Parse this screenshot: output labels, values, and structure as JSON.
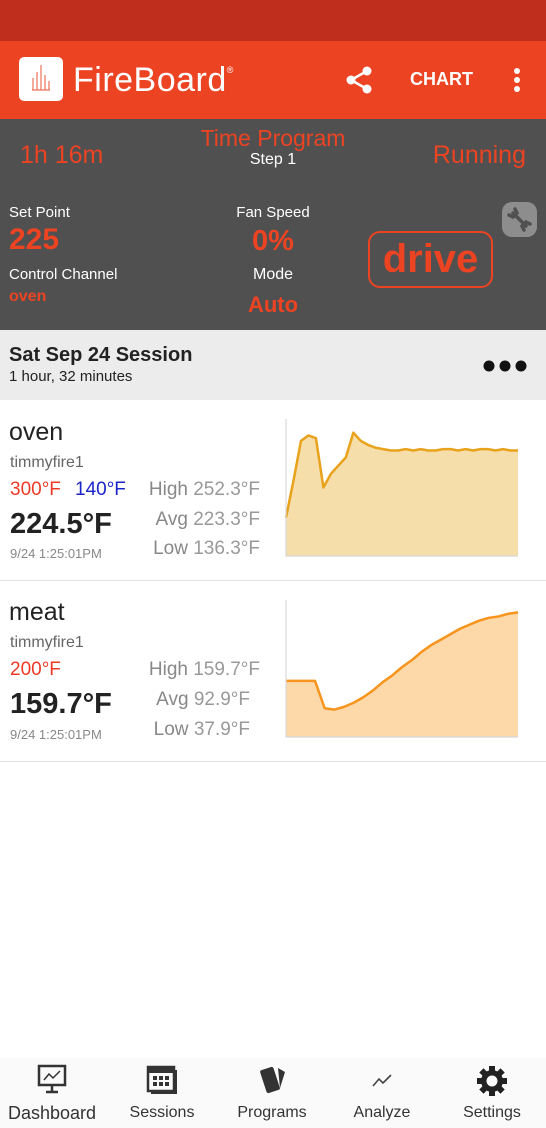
{
  "app": {
    "name": "FireBoard",
    "trademark": "®",
    "chart_label": "CHART"
  },
  "icons": {
    "logo": "fireboard-logo-icon",
    "share": "share-icon",
    "more": "more-vert-icon",
    "wrench": "wrench-icon",
    "session_more": "more-horiz-icon"
  },
  "control": {
    "elapsed": "1h 16m",
    "program_title": "Time Program",
    "program_step": "Step 1",
    "status": "Running",
    "setpoint_label": "Set Point",
    "setpoint_value": "225",
    "channel_label": "Control Channel",
    "channel_value": "oven",
    "fan_label": "Fan Speed",
    "fan_value": "0%",
    "mode_label": "Mode",
    "mode_value": "Auto",
    "drive_label": "drive"
  },
  "session": {
    "title": "Sat Sep 24 Session",
    "duration": "1 hour, 32 minutes"
  },
  "probes": [
    {
      "name": "oven",
      "device": "timmyfire1",
      "alarm_high": "300°F",
      "alarm_low": "140°F",
      "current": "224.5°F",
      "timestamp": "9/24 1:25:01PM",
      "high_label": "High",
      "high": "252.3°F",
      "avg_label": "Avg",
      "avg": "223.3°F",
      "low_label": "Low",
      "low": "136.3°F",
      "line_color": "#e8a21b",
      "fill_color": "#f6deaa",
      "trend": [
        0.28,
        0.55,
        0.84,
        0.88,
        0.86,
        0.5,
        0.6,
        0.66,
        0.72,
        0.9,
        0.84,
        0.81,
        0.79,
        0.78,
        0.77,
        0.77,
        0.78,
        0.77,
        0.78,
        0.77,
        0.77,
        0.78,
        0.78,
        0.77,
        0.78,
        0.77,
        0.78,
        0.78,
        0.77,
        0.78,
        0.77,
        0.77
      ]
    },
    {
      "name": "meat",
      "device": "timmyfire1",
      "alarm_high": "200°F",
      "alarm_low": "",
      "current": "159.7°F",
      "timestamp": "9/24 1:25:01PM",
      "high_label": "High",
      "high": "159.7°F",
      "avg_label": "Avg",
      "avg": "92.9°F",
      "low_label": "Low",
      "low": "37.9°F",
      "line_color": "#f7941d",
      "fill_color": "#fdd8a8",
      "trend": [
        0.41,
        0.41,
        0.41,
        0.41,
        0.21,
        0.2,
        0.22,
        0.25,
        0.29,
        0.34,
        0.4,
        0.45,
        0.51,
        0.56,
        0.62,
        0.67,
        0.71,
        0.75,
        0.79,
        0.82,
        0.85,
        0.87,
        0.88,
        0.9,
        0.91
      ]
    }
  ],
  "nav": [
    {
      "label": "Dashboard",
      "icon": "dashboard-icon"
    },
    {
      "label": "Sessions",
      "icon": "calendar-icon"
    },
    {
      "label": "Programs",
      "icon": "programs-cards-icon"
    },
    {
      "label": "Analyze",
      "icon": "analyze-trend-icon"
    },
    {
      "label": "Settings",
      "icon": "gear-icon"
    }
  ]
}
